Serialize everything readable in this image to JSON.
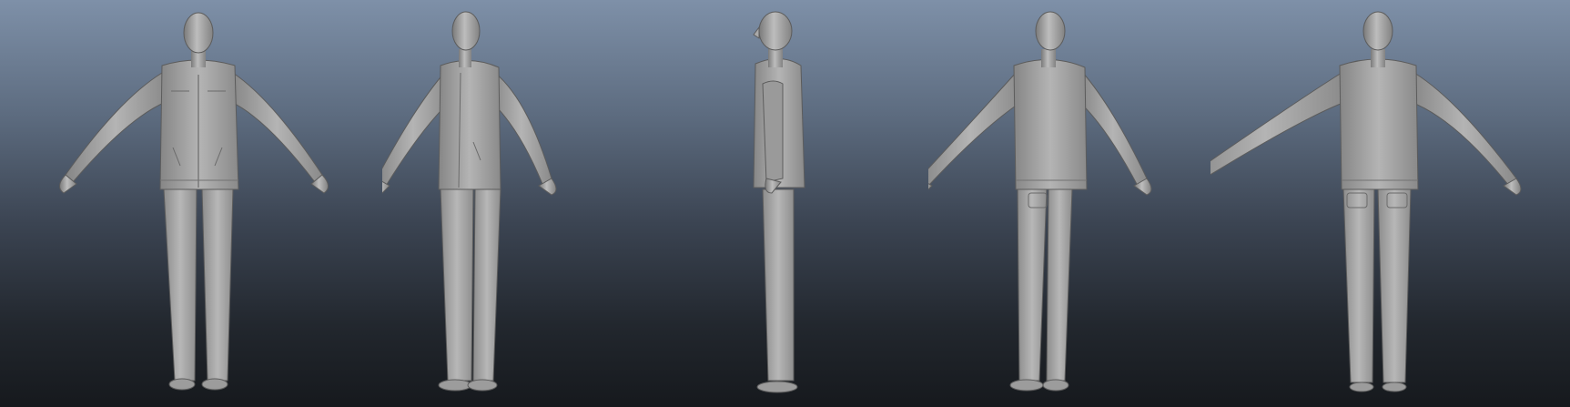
{
  "viewport": {
    "background_top": "#7e90a8",
    "background_bottom": "#16191d",
    "model_color": "#a9a9a9",
    "model_shadow": "#6f6f6f",
    "model_highlight": "#cfcfcf"
  },
  "views": [
    {
      "id": "front",
      "icon": "character-model-front"
    },
    {
      "id": "three-quarter-front",
      "icon": "character-model-three-quarter"
    },
    {
      "id": "side",
      "icon": "character-model-side"
    },
    {
      "id": "three-quarter-back",
      "icon": "character-model-three-quarter-back"
    },
    {
      "id": "back",
      "icon": "character-model-back"
    }
  ]
}
